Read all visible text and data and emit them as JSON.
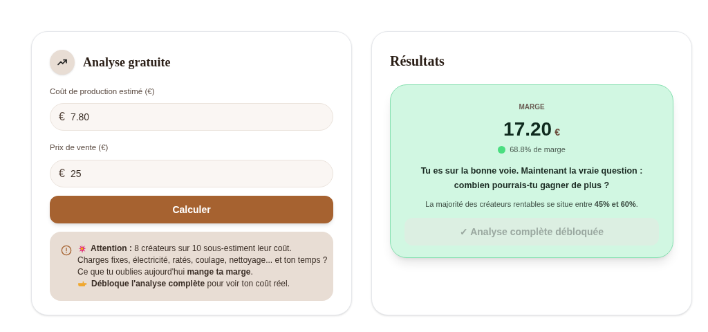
{
  "analysis": {
    "title": "Analyse gratuite",
    "fields": [
      {
        "label": "Coût de production estimé (€)",
        "prefix": "€",
        "value": "7.80"
      },
      {
        "label": "Prix de vente (€)",
        "prefix": "€",
        "value": "25"
      }
    ],
    "button": "Calculer",
    "notice": [
      {
        "kind": "alert",
        "text": "**Attention :** 8 créateurs sur 10 sous-estiment leur coût."
      },
      {
        "kind": "plain",
        "text": "Charges fixes, électricité, ratés, coulage, nettoyage... et ton temps ?"
      },
      {
        "kind": "plain",
        "text": "Ce que tu oublies aujourd'hui **mange ta marge**."
      },
      {
        "kind": "cta",
        "text": "**Débloque l'analyse complète** pour voir ton coût réel."
      }
    ]
  },
  "results": {
    "title": "Résultats",
    "label": "MARGE",
    "amount": "17.20",
    "currency": "€",
    "indicator": {
      "color": "#4ade80"
    },
    "percent": "68.8% de marge",
    "message": "Tu es sur la bonne voie. Maintenant la vraie question : combien pourrais-tu gagner de plus ?",
    "note": "La majorité des créateurs rentables se situe entre **45% et 60%**.",
    "unlock_button": {
      "label": "✓ Analyse complète débloquée",
      "disabled": true
    }
  }
}
